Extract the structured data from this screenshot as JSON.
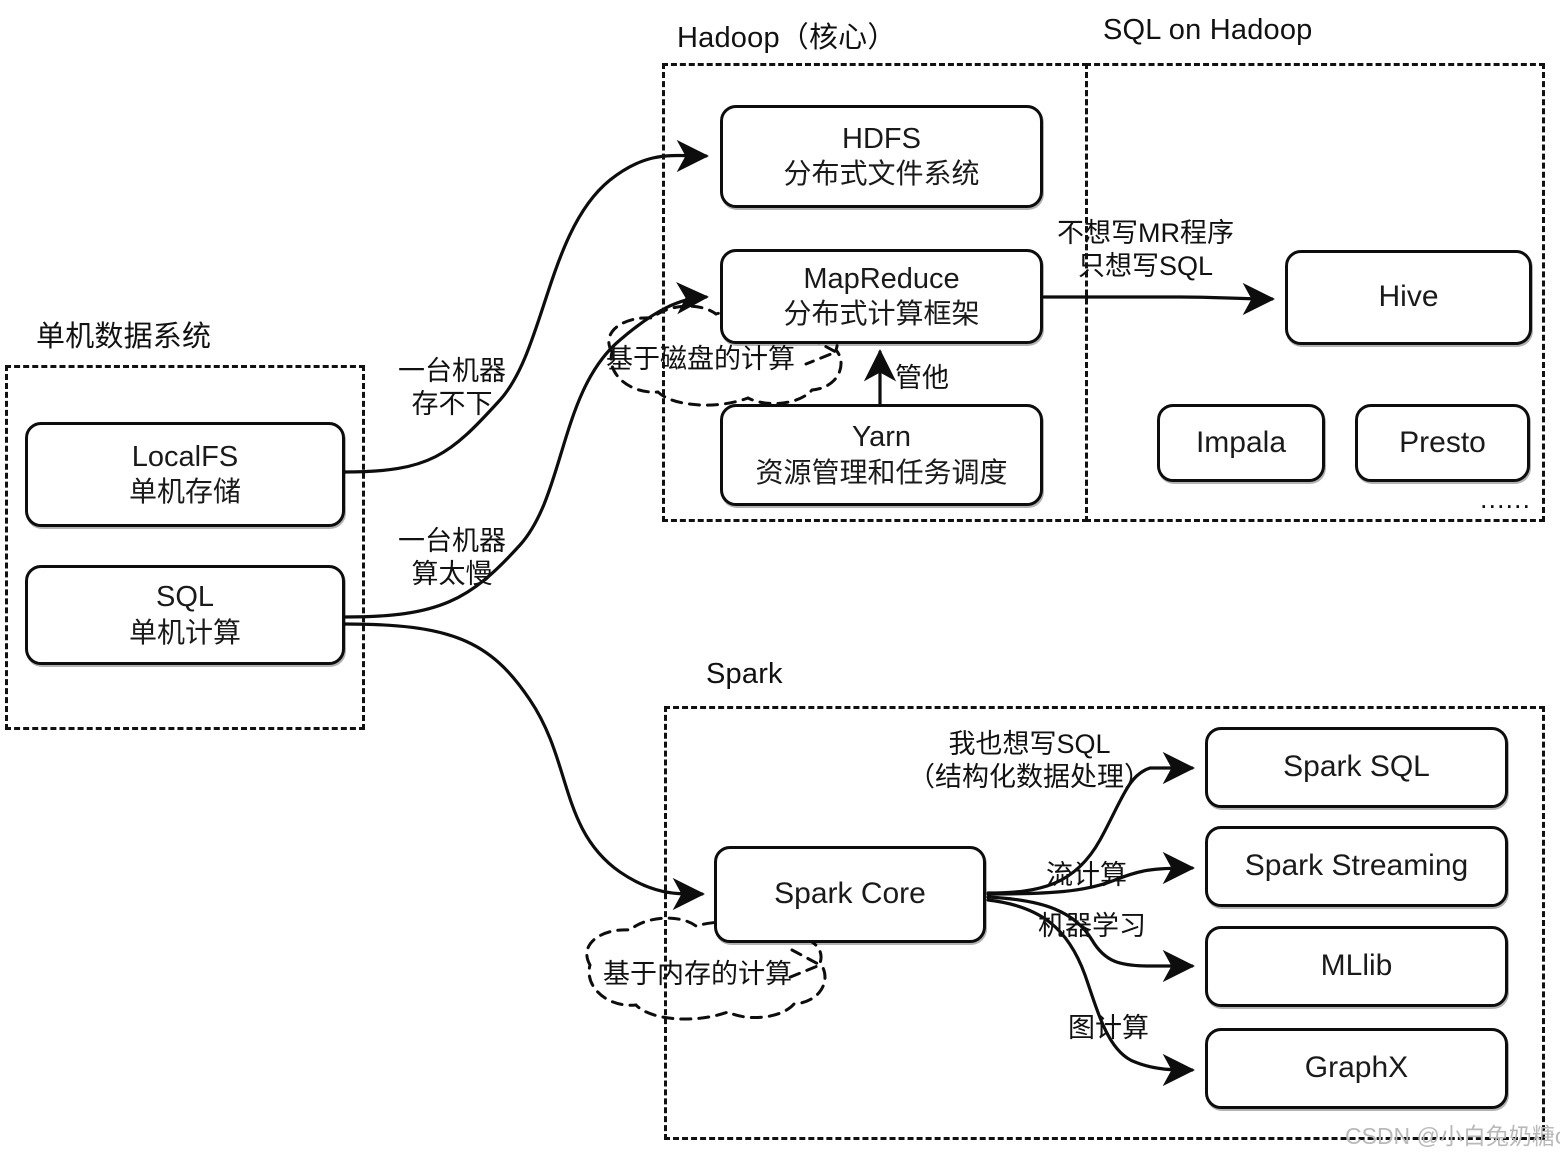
{
  "diagram": {
    "title_groups": {
      "hadoop_core": "Hadoop（核心）",
      "sql_on_hadoop": "SQL on Hadoop",
      "standalone": "单机数据系统",
      "spark": "Spark"
    },
    "nodes": {
      "localfs": {
        "name": "LocalFS",
        "sub": "单机存储"
      },
      "sql_local": {
        "name": "SQL",
        "sub": "单机计算"
      },
      "hdfs": {
        "name": "HDFS",
        "sub": "分布式文件系统"
      },
      "mapreduce": {
        "name": "MapReduce",
        "sub": "分布式计算框架"
      },
      "yarn": {
        "name": "Yarn",
        "sub": "资源管理和任务调度"
      },
      "hive": {
        "name": "Hive",
        "sub": ""
      },
      "impala": {
        "name": "Impala",
        "sub": ""
      },
      "presto": {
        "name": "Presto",
        "sub": ""
      },
      "spark_core": {
        "name": "Spark Core",
        "sub": ""
      },
      "spark_sql": {
        "name": "Spark SQL",
        "sub": ""
      },
      "spark_streaming": {
        "name": "Spark Streaming",
        "sub": ""
      },
      "mllib": {
        "name": "MLlib",
        "sub": ""
      },
      "graphx": {
        "name": "GraphX",
        "sub": ""
      }
    },
    "edge_labels": {
      "storage_limit_l1": "一台机器",
      "storage_limit_l2": "存不下",
      "compute_slow_l1": "一台机器",
      "compute_slow_l2": "算太慢",
      "no_mr_l1": "不想写MR程序",
      "no_mr_l2": "只想写SQL",
      "yarn_manages": "管他",
      "spark_sql_l1": "我也想写SQL",
      "spark_sql_l2": "（结构化数据处理）",
      "streaming": "流计算",
      "ml": "机器学习",
      "graph": "图计算"
    },
    "annotations": {
      "disk_based": "基于磁盘的计算",
      "memory_based": "基于内存的计算"
    },
    "misc": {
      "more_dots": "......",
      "watermark": "CSDN @小白兔奶糖ovo"
    }
  }
}
